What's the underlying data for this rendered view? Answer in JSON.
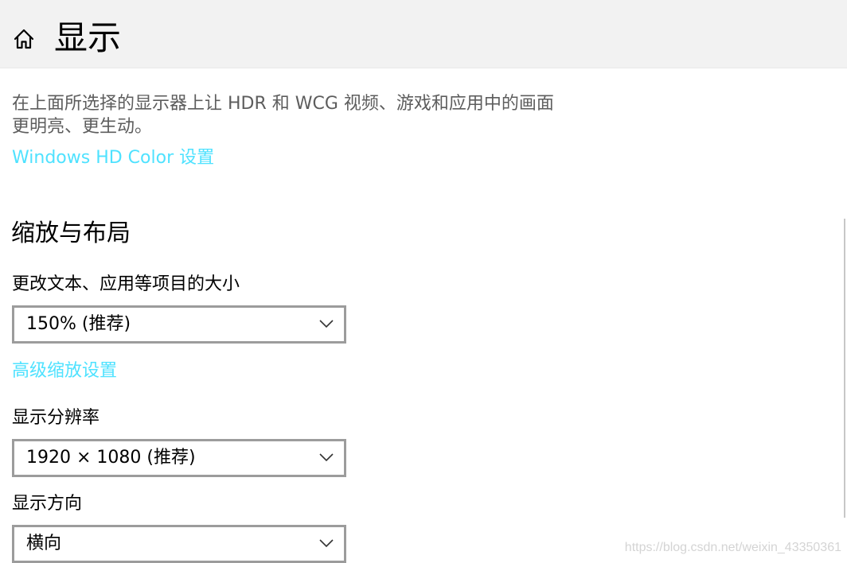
{
  "header": {
    "home_icon": "home-icon",
    "title": "显示"
  },
  "hdr": {
    "description": "在上面所选择的显示器上让 HDR 和 WCG 视频、游戏和应用中的画面更明亮、更生动。",
    "link": "Windows HD Color 设置"
  },
  "scale_layout": {
    "section_title": "缩放与布局",
    "size_label": "更改文本、应用等项目的大小",
    "size_value": "150% (推荐)",
    "advanced_link": "高级缩放设置",
    "resolution_label": "显示分辨率",
    "resolution_value": "1920 × 1080 (推荐)",
    "orientation_label": "显示方向",
    "orientation_value": "横向"
  },
  "icons": {
    "dropdown": "chevron-down-icon"
  },
  "colors": {
    "link": "#4fe2ff",
    "header_bg": "#f2f2f2",
    "select_border": "#9c9c9c",
    "description_text": "#5d5d5d"
  },
  "watermark": "https://blog.csdn.net/weixin_43350361"
}
